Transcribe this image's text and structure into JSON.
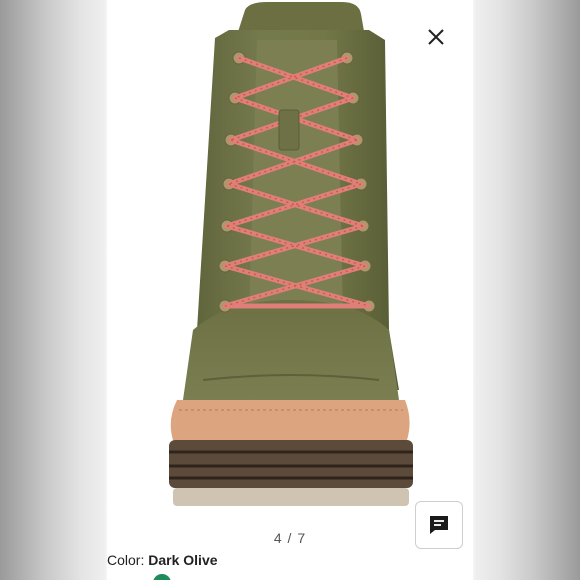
{
  "viewer": {
    "counter": "4 / 7",
    "close_icon": "close-icon",
    "chat_icon": "chat-bubble-icon"
  },
  "product": {
    "color_label": "Color:",
    "color_value": "Dark Olive"
  },
  "colors": {
    "boot_leather": "#6e7146",
    "laces": "#e07f7a",
    "sole_gum": "#d9a27c",
    "sole_dark": "#5b4a3a"
  }
}
